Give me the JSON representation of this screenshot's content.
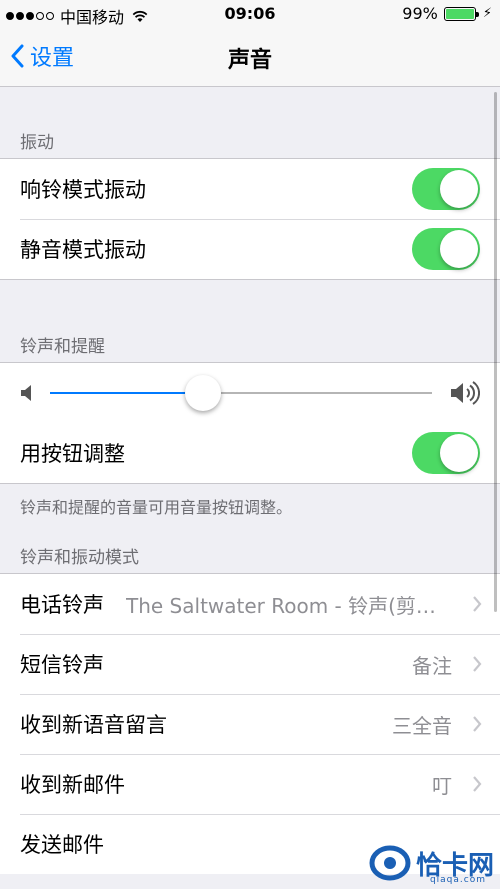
{
  "status_bar": {
    "carrier": "中国移动",
    "time": "09:06",
    "battery_percent": "99%",
    "battery_level": 0.99,
    "signal_bars": 3
  },
  "nav": {
    "back_label": "设置",
    "title": "声音"
  },
  "vibrate": {
    "header": "振动",
    "rows": [
      {
        "label": "响铃模式振动",
        "on": true
      },
      {
        "label": "静音模式振动",
        "on": true
      }
    ]
  },
  "ringer": {
    "header": "铃声和提醒",
    "volume_level": 0.4,
    "adjust_label": "用按钮调整",
    "adjust_on": true,
    "footnote": "铃声和提醒的音量可用音量按钮调整。"
  },
  "patterns": {
    "header": "铃声和振动模式",
    "rows": [
      {
        "label": "电话铃声",
        "value": "The Saltwater Room - 铃声(剪…"
      },
      {
        "label": "短信铃声",
        "value": "备注"
      },
      {
        "label": "收到新语音留言",
        "value": "三全音"
      },
      {
        "label": "收到新邮件",
        "value": "叮"
      },
      {
        "label": "发送邮件",
        "value": ""
      }
    ]
  },
  "colors": {
    "accent": "#007aff",
    "toggle_on": "#4cd964",
    "background": "#efeff4"
  },
  "watermark": {
    "text": "恰卡网",
    "sub": "qiaqa.com"
  }
}
